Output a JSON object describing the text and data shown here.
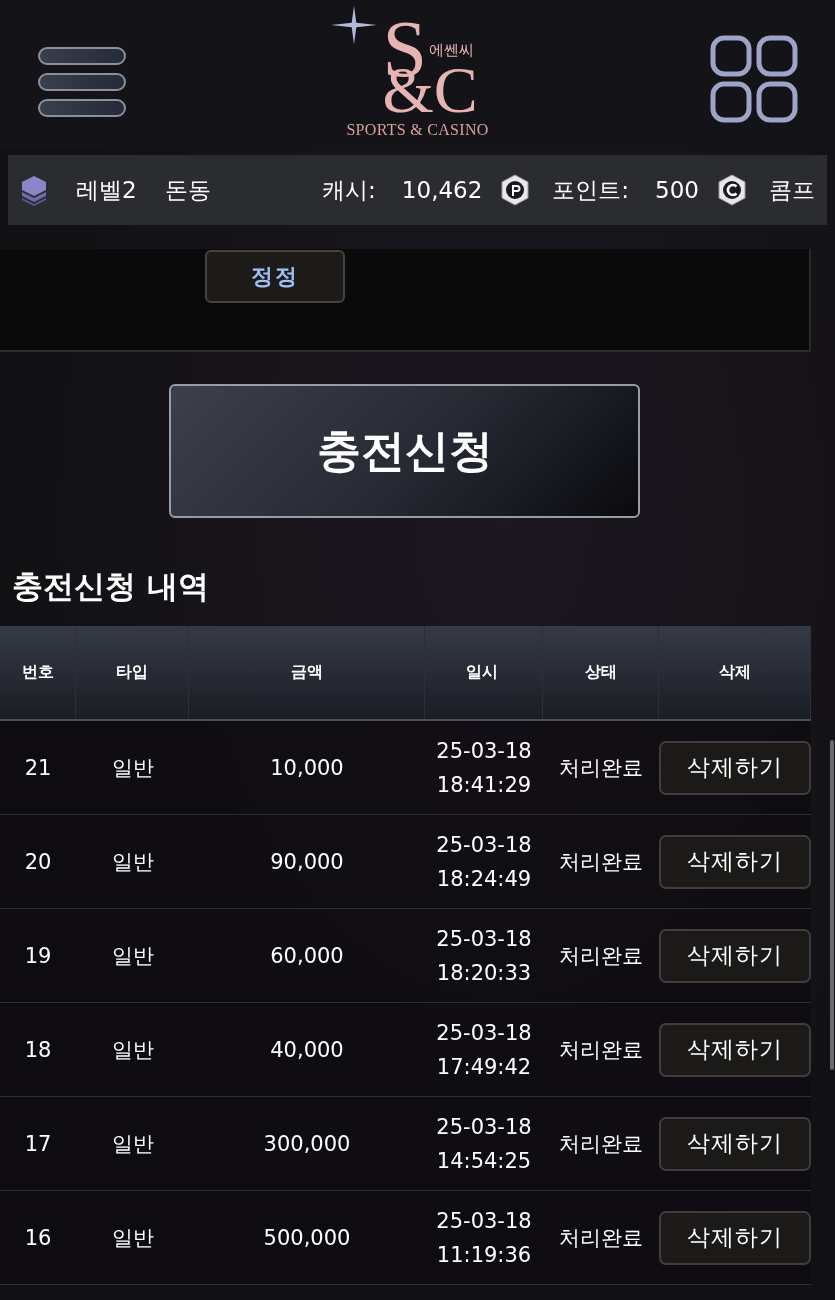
{
  "header": {
    "logo": {
      "letter_top": "S",
      "letter_bottom": "&C",
      "korean": "에쎈씨",
      "tagline": "SPORTS & CASINO"
    }
  },
  "info_bar": {
    "level": "레벨2",
    "nickname": "돈동",
    "cash_label": "캐시:",
    "cash": "10,462",
    "point_label": "포인트:",
    "point": "500",
    "comp_label": "콤프"
  },
  "correct_button": "정정",
  "submit_button": "충전신청",
  "history": {
    "title": "충전신청 내역",
    "columns": [
      "번호",
      "타입",
      "금액",
      "일시",
      "상태",
      "삭제"
    ],
    "rows": [
      {
        "no": "21",
        "type": "일반",
        "amount": "10,000",
        "date": "25-03-18",
        "time": "18:41:29",
        "status": "처리완료",
        "action": "삭제하기"
      },
      {
        "no": "20",
        "type": "일반",
        "amount": "90,000",
        "date": "25-03-18",
        "time": "18:24:49",
        "status": "처리완료",
        "action": "삭제하기"
      },
      {
        "no": "19",
        "type": "일반",
        "amount": "60,000",
        "date": "25-03-18",
        "time": "18:20:33",
        "status": "처리완료",
        "action": "삭제하기"
      },
      {
        "no": "18",
        "type": "일반",
        "amount": "40,000",
        "date": "25-03-18",
        "time": "17:49:42",
        "status": "처리완료",
        "action": "삭제하기"
      },
      {
        "no": "17",
        "type": "일반",
        "amount": "300,000",
        "date": "25-03-18",
        "time": "14:54:25",
        "status": "처리완료",
        "action": "삭제하기"
      },
      {
        "no": "16",
        "type": "일반",
        "amount": "500,000",
        "date": "25-03-18",
        "time": "11:19:36",
        "status": "처리완료",
        "action": "삭제하기"
      }
    ]
  }
}
